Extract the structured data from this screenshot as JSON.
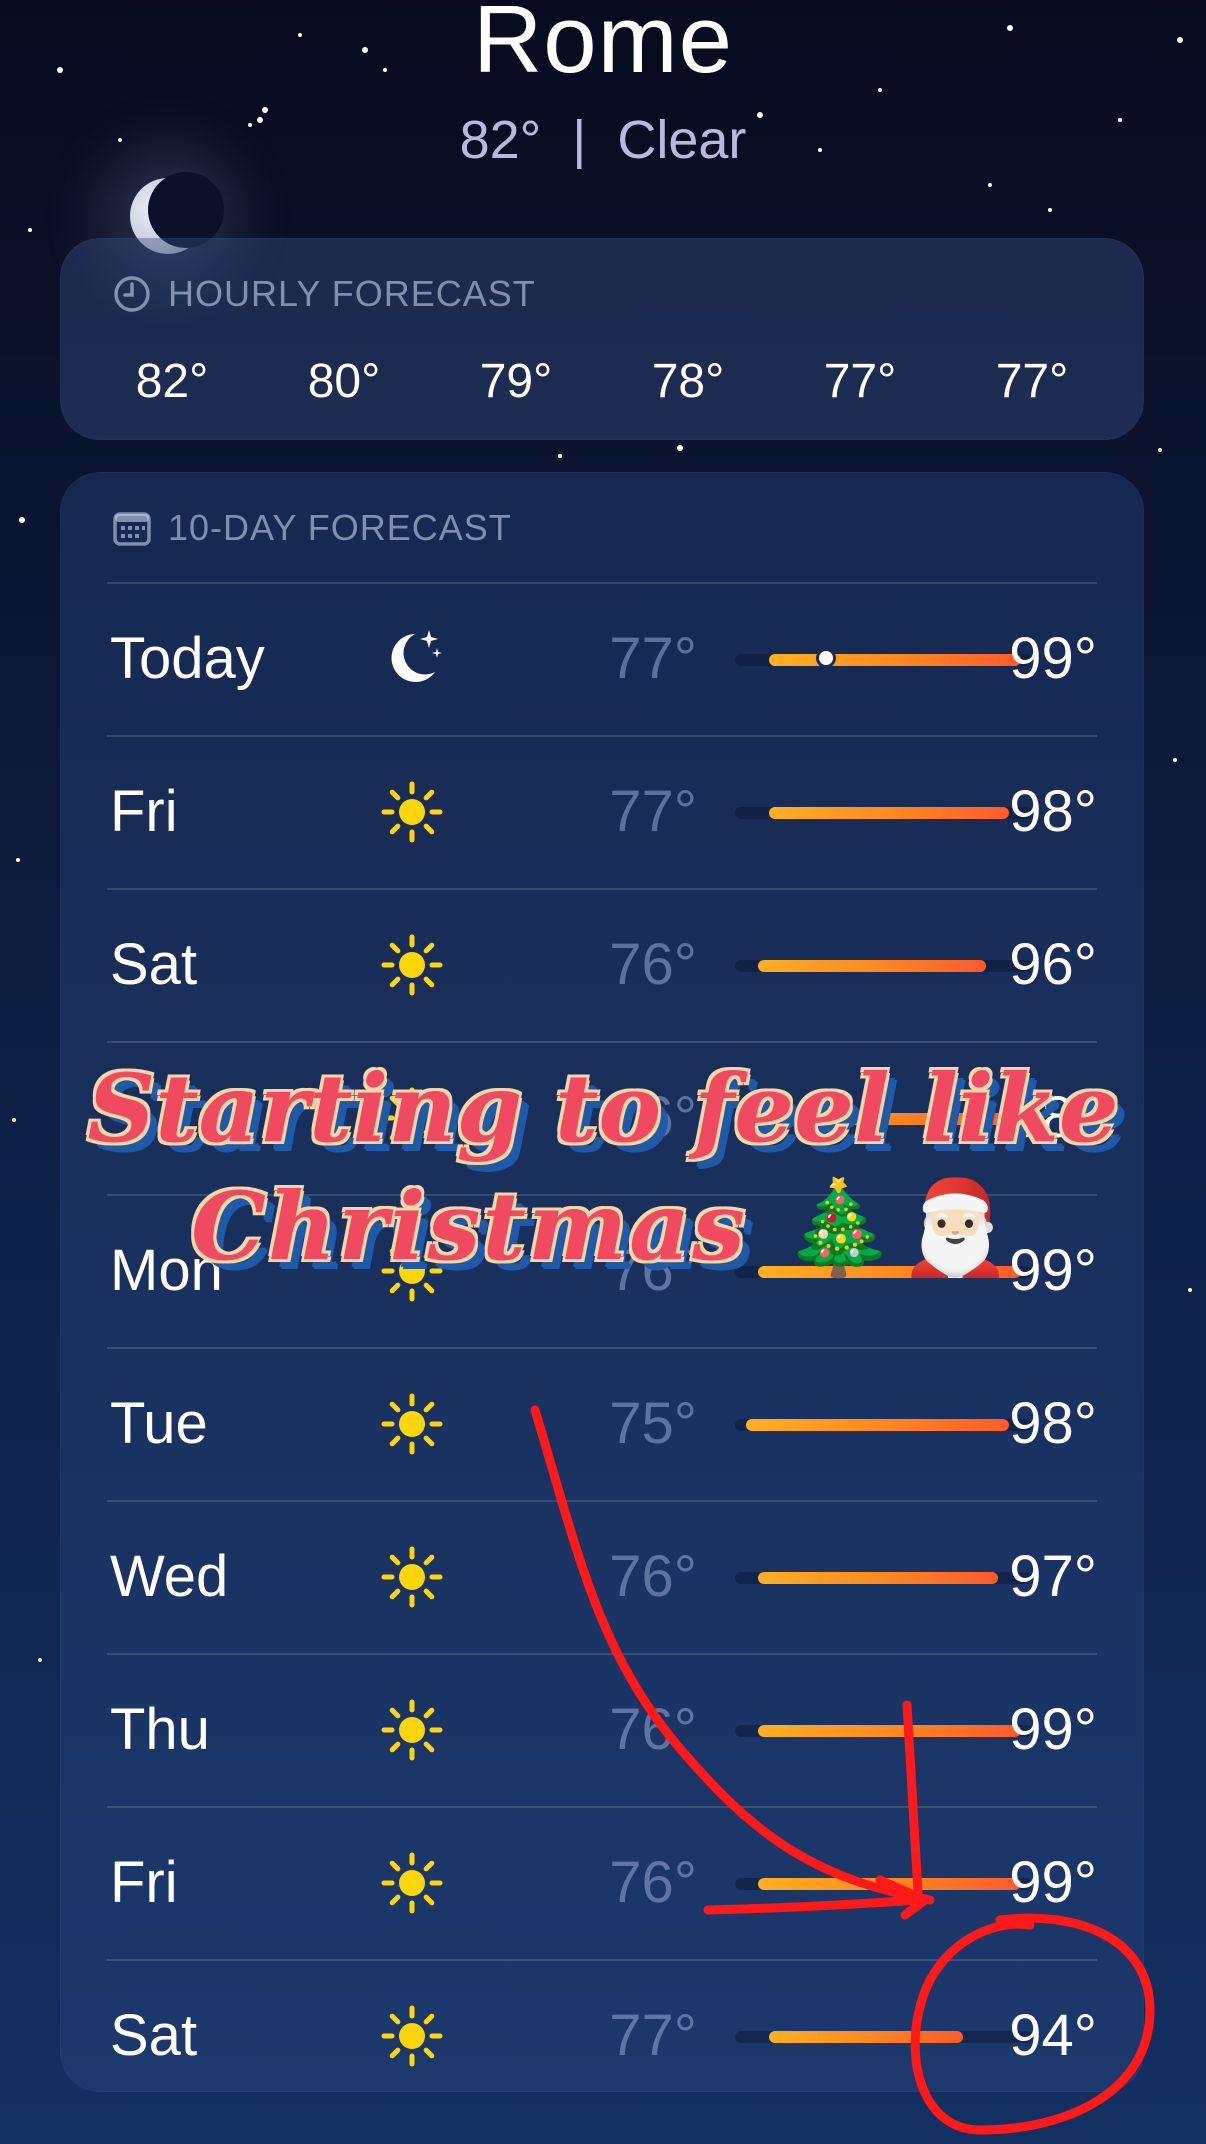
{
  "location": {
    "city": "Rome",
    "current_temp": "82°",
    "separator": "|",
    "condition": "Clear"
  },
  "hourly": {
    "header": "HOURLY FORECAST",
    "icon": "clock-icon",
    "temps": [
      "82°",
      "80°",
      "79°",
      "78°",
      "77°",
      "77°"
    ]
  },
  "daily": {
    "header": "10-DAY FORECAST",
    "icon": "calendar-icon",
    "range_min": 74,
    "range_max": 100,
    "days": [
      {
        "day": "Today",
        "icon": "moon-stars-icon",
        "low": "77°",
        "high": "99°",
        "lo_val": 77,
        "hi_val": 99,
        "current": 82
      },
      {
        "day": "Fri",
        "icon": "sun-icon",
        "low": "77°",
        "high": "98°",
        "lo_val": 77,
        "hi_val": 98
      },
      {
        "day": "Sat",
        "icon": "sun-icon",
        "low": "76°",
        "high": "96°",
        "lo_val": 76,
        "hi_val": 96
      },
      {
        "day": "",
        "icon": "sun-icon",
        "low": "76°",
        "high": "98°",
        "lo_val": 76,
        "hi_val": 98
      },
      {
        "day": "Mon",
        "icon": "sun-icon",
        "low": "76°",
        "high": "99°",
        "lo_val": 76,
        "hi_val": 99
      },
      {
        "day": "Tue",
        "icon": "sun-icon",
        "low": "75°",
        "high": "98°",
        "lo_val": 75,
        "hi_val": 98
      },
      {
        "day": "Wed",
        "icon": "sun-icon",
        "low": "76°",
        "high": "97°",
        "lo_val": 76,
        "hi_val": 97
      },
      {
        "day": "Thu",
        "icon": "sun-icon",
        "low": "76°",
        "high": "99°",
        "lo_val": 76,
        "hi_val": 99
      },
      {
        "day": "Fri",
        "icon": "sun-icon",
        "low": "76°",
        "high": "99°",
        "lo_val": 76,
        "hi_val": 99
      },
      {
        "day": "Sat",
        "icon": "sun-icon",
        "low": "77°",
        "high": "94°",
        "lo_val": 77,
        "hi_val": 94
      }
    ]
  },
  "overlay": {
    "line1": "Starting to feel like",
    "line2": "Christmas",
    "emoji": "🎄🎅🏻"
  },
  "colors": {
    "bar_start": "#ffb020",
    "bar_end": "#ff5a2a",
    "annotation": "#ff1a1a",
    "overlay_text": "#ef4a5f"
  }
}
